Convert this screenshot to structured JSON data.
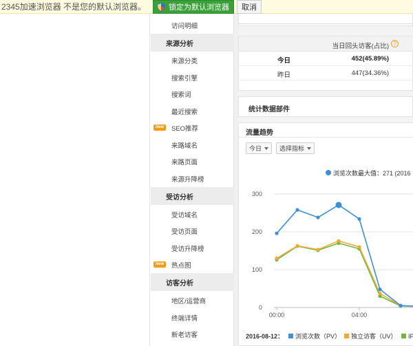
{
  "topbar": {
    "message": "2345加速浏览器 不是您的默认浏览器。",
    "set_default_label": "锁定为默认浏览器",
    "cancel_label": "取消"
  },
  "sidebar": {
    "items": [
      {
        "type": "item",
        "label": "访问明细"
      },
      {
        "type": "head",
        "label": "来源分析"
      },
      {
        "type": "item",
        "label": "来源分类"
      },
      {
        "type": "item",
        "label": "搜索引擎"
      },
      {
        "type": "item",
        "label": "搜索词"
      },
      {
        "type": "item",
        "label": "最近搜索"
      },
      {
        "type": "item",
        "label": "SEO推荐",
        "badge": "New"
      },
      {
        "type": "item",
        "label": "来路域名"
      },
      {
        "type": "item",
        "label": "来路页面"
      },
      {
        "type": "item",
        "label": "来源升降榜"
      },
      {
        "type": "head",
        "label": "受访分析"
      },
      {
        "type": "item",
        "label": "受访域名"
      },
      {
        "type": "item",
        "label": "受访页面"
      },
      {
        "type": "item",
        "label": "受访升降榜"
      },
      {
        "type": "item",
        "label": "热点图",
        "badge": "New"
      },
      {
        "type": "head",
        "label": "访客分析"
      },
      {
        "type": "item",
        "label": "地区/运营商"
      },
      {
        "type": "item",
        "label": "终端详情"
      },
      {
        "type": "item",
        "label": "新老访客"
      }
    ]
  },
  "returning": {
    "header": "当日回头访客(占比)",
    "help": "?",
    "rows": [
      {
        "label": "今日",
        "value": "452(45.89%)"
      },
      {
        "label": "昨日",
        "value": "447(34.36%)"
      }
    ]
  },
  "stats_widget": {
    "title": "统计数据部件"
  },
  "trend": {
    "title": "流量趋势",
    "period_select": "今日",
    "metric_select": "选择指标",
    "annotation": "浏览次数最大值：271 (2016",
    "date_label": "2016-08-12：",
    "legend": [
      "浏览次数（PV）",
      "独立访客（UV）",
      "IP"
    ]
  },
  "chart_data": {
    "type": "line",
    "x": [
      0,
      1,
      2,
      3,
      4,
      5,
      6,
      7,
      8
    ],
    "xticks": [
      "00:00",
      "04:00"
    ],
    "yticks": [
      "0",
      "100",
      "200",
      "300"
    ],
    "ylim": [
      0,
      320
    ],
    "series": [
      {
        "name": "浏览次数（PV）",
        "color": "#3d8fd6",
        "values": [
          196,
          258,
          238,
          271,
          234,
          48,
          5,
          3,
          3
        ]
      },
      {
        "name": "独立访客（UV）",
        "color": "#f3a83b",
        "values": [
          130,
          163,
          153,
          176,
          160,
          37,
          5,
          2,
          2
        ]
      },
      {
        "name": "IP",
        "color": "#6cba3a",
        "values": [
          126,
          162,
          151,
          170,
          155,
          30,
          4,
          2,
          2
        ]
      }
    ]
  }
}
